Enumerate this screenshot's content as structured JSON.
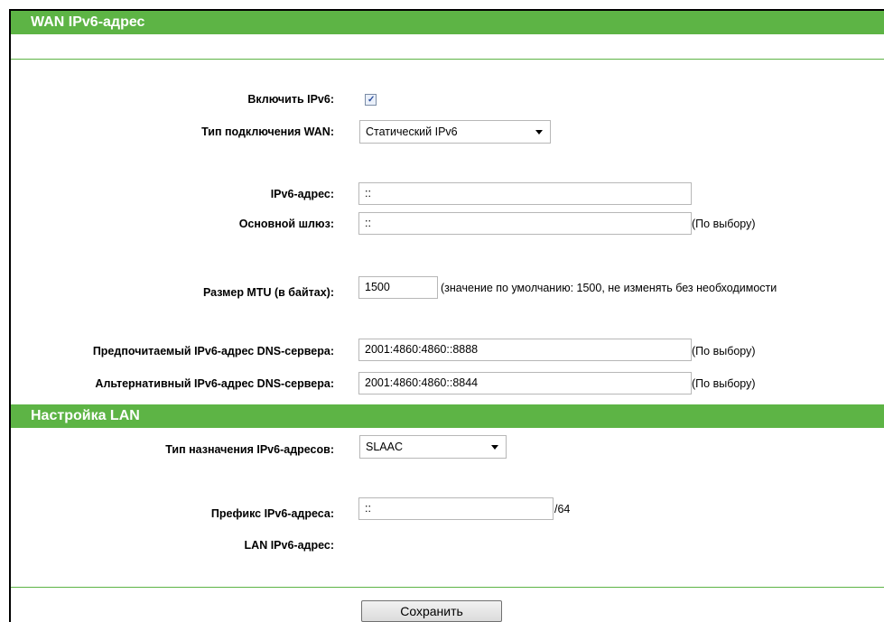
{
  "wan": {
    "title": "WAN IPv6-адрес",
    "enable_ipv6_label": "Включить IPv6:",
    "enable_ipv6_checked": true,
    "connection_type_label": "Тип подключения WAN:",
    "connection_type_value": "Статический IPv6",
    "ipv6_address_label": "IPv6-адрес:",
    "ipv6_address_value": "::",
    "default_gateway_label": "Основной шлюз:",
    "default_gateway_value": "::",
    "optional_note": "(По выбору)",
    "mtu_label": "Размер MTU (в байтах):",
    "mtu_value": "1500",
    "mtu_note": "(значение по умолчанию: 1500, не изменять без необходимости",
    "primary_dns_label": "Предпочитаемый IPv6-адрес DNS-сервера:",
    "primary_dns_value": "2001:4860:4860::8888",
    "secondary_dns_label": "Альтернативный IPv6-адрес DNS-сервера:",
    "secondary_dns_value": "2001:4860:4860::8844"
  },
  "lan": {
    "title": "Настройка LAN",
    "assign_type_label": "Тип назначения IPv6-адресов:",
    "assign_type_value": "SLAAC",
    "prefix_label": "Префикс IPv6-адреса:",
    "prefix_value": "::",
    "prefix_suffix": "/64",
    "lan_ipv6_label": "LAN IPv6-адрес:",
    "lan_ipv6_value": ""
  },
  "actions": {
    "save_label": "Сохранить"
  },
  "colors": {
    "header_green": "#5db445"
  },
  "icons": {
    "checkbox": "checkmark-icon",
    "dropdown": "chevron-down-icon"
  }
}
